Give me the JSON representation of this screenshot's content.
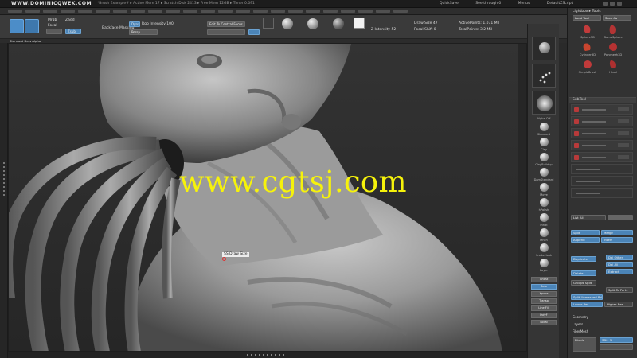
{
  "titlebar": {
    "brand": "WWW.DOMINICQWEK.COM",
    "window_title": "*Brush Example# ▸ Active Mem 17 ▸ Scratch Disk 2413 ▸ Free Mem 12GB ▸ Timer 0.091",
    "quicksave": "QuickSave",
    "see_through": "See-through 0",
    "menus": "Menus",
    "default_script": "DefaultZScript"
  },
  "toolbar": {
    "row1": "Brush  Edit  Draw  Move  Scale  Rotate",
    "focal": "Focal",
    "mrgb": "Mrgb",
    "zadd": "Zadd",
    "sub": "Zsub",
    "backface": "Backface Masking",
    "dynamic": "Dynamic",
    "persp": "Persp",
    "edit_to_central": "Edit To Central Focus",
    "rgb_intensity": "Rgb Intensity 100",
    "z_intensity": "Z Intensity 52",
    "draw_size": "Draw Size 47",
    "focal_shift": "Focal Shift 0",
    "active_points": "ActivePoints: 1.071 Mil",
    "total_points": "TotalPoints: 3.2 Mil"
  },
  "subbar": {
    "label": "Standard  Dots  Alpha"
  },
  "canvas": {
    "watermark": "www.cgtsj.com",
    "cursor_label": "SS Draw Size"
  },
  "shelf": {
    "labels": [
      "Alpha Off",
      "Standard",
      "Clay",
      "ClayBuildup",
      "DamStandard",
      "Move",
      "hPolish",
      "Inflat",
      "Pinch",
      "SnakeHook",
      "Layer",
      "TrimDynamic",
      "Slash3",
      "Smooth",
      "Transpose"
    ],
    "buttons": [
      "Ghost",
      "Solo",
      "Xpose",
      "Transp",
      "Line Fill",
      "PolyF",
      "Local"
    ]
  },
  "palette": {
    "title": "Lightbox ▸ Tools",
    "load_tool": "Load Tool",
    "save_as": "Save As",
    "subtool_title": "SubTool",
    "list_all": "List All",
    "split": "Split",
    "merge": "Merge",
    "append": "Append",
    "insert": "Insert",
    "duplicate": "Duplicate",
    "delete": "Delete",
    "del_other": "Del Other",
    "del_all": "Del All",
    "extract": "Extract",
    "groups_split": "Groups Split",
    "split_to_parts": "Split To Parts",
    "split_unmasked": "Split Unmasked Points",
    "geometry": "Geometry",
    "lower_res": "Lower Res",
    "higher_res": "Higher Res",
    "sdiv": "SDiv 5",
    "divide": "Divide",
    "layers": "Layers",
    "fiber_mesh": "FiberMesh",
    "tools": [
      "Sphere3D",
      "DomeSphere",
      "Cylinder3D",
      "Polymesh3D",
      "SimpleBrush",
      "Head"
    ]
  },
  "colors": {
    "accent_blue": "#4b84b7",
    "watermark": "#f6f20b",
    "subtool_red": "#b83a3a"
  }
}
